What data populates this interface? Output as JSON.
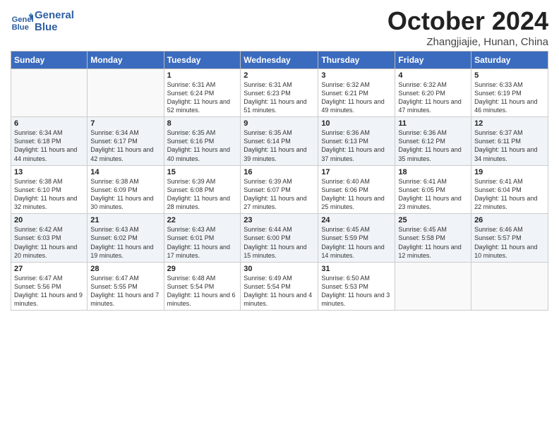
{
  "logo": {
    "line1": "General",
    "line2": "Blue"
  },
  "title": "October 2024",
  "location": "Zhangjiajie, Hunan, China",
  "headers": [
    "Sunday",
    "Monday",
    "Tuesday",
    "Wednesday",
    "Thursday",
    "Friday",
    "Saturday"
  ],
  "weeks": [
    [
      {
        "day": "",
        "info": ""
      },
      {
        "day": "",
        "info": ""
      },
      {
        "day": "1",
        "info": "Sunrise: 6:31 AM\nSunset: 6:24 PM\nDaylight: 11 hours and 52 minutes."
      },
      {
        "day": "2",
        "info": "Sunrise: 6:31 AM\nSunset: 6:23 PM\nDaylight: 11 hours and 51 minutes."
      },
      {
        "day": "3",
        "info": "Sunrise: 6:32 AM\nSunset: 6:21 PM\nDaylight: 11 hours and 49 minutes."
      },
      {
        "day": "4",
        "info": "Sunrise: 6:32 AM\nSunset: 6:20 PM\nDaylight: 11 hours and 47 minutes."
      },
      {
        "day": "5",
        "info": "Sunrise: 6:33 AM\nSunset: 6:19 PM\nDaylight: 11 hours and 46 minutes."
      }
    ],
    [
      {
        "day": "6",
        "info": "Sunrise: 6:34 AM\nSunset: 6:18 PM\nDaylight: 11 hours and 44 minutes."
      },
      {
        "day": "7",
        "info": "Sunrise: 6:34 AM\nSunset: 6:17 PM\nDaylight: 11 hours and 42 minutes."
      },
      {
        "day": "8",
        "info": "Sunrise: 6:35 AM\nSunset: 6:16 PM\nDaylight: 11 hours and 40 minutes."
      },
      {
        "day": "9",
        "info": "Sunrise: 6:35 AM\nSunset: 6:14 PM\nDaylight: 11 hours and 39 minutes."
      },
      {
        "day": "10",
        "info": "Sunrise: 6:36 AM\nSunset: 6:13 PM\nDaylight: 11 hours and 37 minutes."
      },
      {
        "day": "11",
        "info": "Sunrise: 6:36 AM\nSunset: 6:12 PM\nDaylight: 11 hours and 35 minutes."
      },
      {
        "day": "12",
        "info": "Sunrise: 6:37 AM\nSunset: 6:11 PM\nDaylight: 11 hours and 34 minutes."
      }
    ],
    [
      {
        "day": "13",
        "info": "Sunrise: 6:38 AM\nSunset: 6:10 PM\nDaylight: 11 hours and 32 minutes."
      },
      {
        "day": "14",
        "info": "Sunrise: 6:38 AM\nSunset: 6:09 PM\nDaylight: 11 hours and 30 minutes."
      },
      {
        "day": "15",
        "info": "Sunrise: 6:39 AM\nSunset: 6:08 PM\nDaylight: 11 hours and 28 minutes."
      },
      {
        "day": "16",
        "info": "Sunrise: 6:39 AM\nSunset: 6:07 PM\nDaylight: 11 hours and 27 minutes."
      },
      {
        "day": "17",
        "info": "Sunrise: 6:40 AM\nSunset: 6:06 PM\nDaylight: 11 hours and 25 minutes."
      },
      {
        "day": "18",
        "info": "Sunrise: 6:41 AM\nSunset: 6:05 PM\nDaylight: 11 hours and 23 minutes."
      },
      {
        "day": "19",
        "info": "Sunrise: 6:41 AM\nSunset: 6:04 PM\nDaylight: 11 hours and 22 minutes."
      }
    ],
    [
      {
        "day": "20",
        "info": "Sunrise: 6:42 AM\nSunset: 6:03 PM\nDaylight: 11 hours and 20 minutes."
      },
      {
        "day": "21",
        "info": "Sunrise: 6:43 AM\nSunset: 6:02 PM\nDaylight: 11 hours and 19 minutes."
      },
      {
        "day": "22",
        "info": "Sunrise: 6:43 AM\nSunset: 6:01 PM\nDaylight: 11 hours and 17 minutes."
      },
      {
        "day": "23",
        "info": "Sunrise: 6:44 AM\nSunset: 6:00 PM\nDaylight: 11 hours and 15 minutes."
      },
      {
        "day": "24",
        "info": "Sunrise: 6:45 AM\nSunset: 5:59 PM\nDaylight: 11 hours and 14 minutes."
      },
      {
        "day": "25",
        "info": "Sunrise: 6:45 AM\nSunset: 5:58 PM\nDaylight: 11 hours and 12 minutes."
      },
      {
        "day": "26",
        "info": "Sunrise: 6:46 AM\nSunset: 5:57 PM\nDaylight: 11 hours and 10 minutes."
      }
    ],
    [
      {
        "day": "27",
        "info": "Sunrise: 6:47 AM\nSunset: 5:56 PM\nDaylight: 11 hours and 9 minutes."
      },
      {
        "day": "28",
        "info": "Sunrise: 6:47 AM\nSunset: 5:55 PM\nDaylight: 11 hours and 7 minutes."
      },
      {
        "day": "29",
        "info": "Sunrise: 6:48 AM\nSunset: 5:54 PM\nDaylight: 11 hours and 6 minutes."
      },
      {
        "day": "30",
        "info": "Sunrise: 6:49 AM\nSunset: 5:54 PM\nDaylight: 11 hours and 4 minutes."
      },
      {
        "day": "31",
        "info": "Sunrise: 6:50 AM\nSunset: 5:53 PM\nDaylight: 11 hours and 3 minutes."
      },
      {
        "day": "",
        "info": ""
      },
      {
        "day": "",
        "info": ""
      }
    ]
  ]
}
